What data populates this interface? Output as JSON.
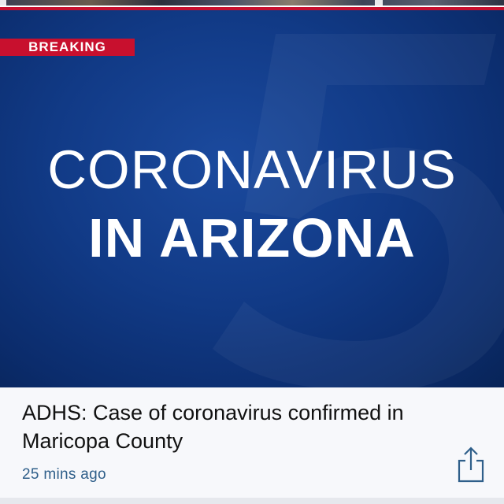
{
  "story_image": {
    "badge": "BREAKING",
    "headline_line1": "CORONAVIRUS",
    "headline_line2": "IN ARIZONA",
    "watermark_digit": "5"
  },
  "article": {
    "title": "ADHS: Case of coronavirus confirmed in Maricopa County",
    "timestamp": "25 mins ago",
    "share_icon": "share-icon"
  },
  "colors": {
    "brand_blue": "#113a86",
    "breaking_red": "#c8102e",
    "timestamp_blue": "#2f5f8a"
  }
}
